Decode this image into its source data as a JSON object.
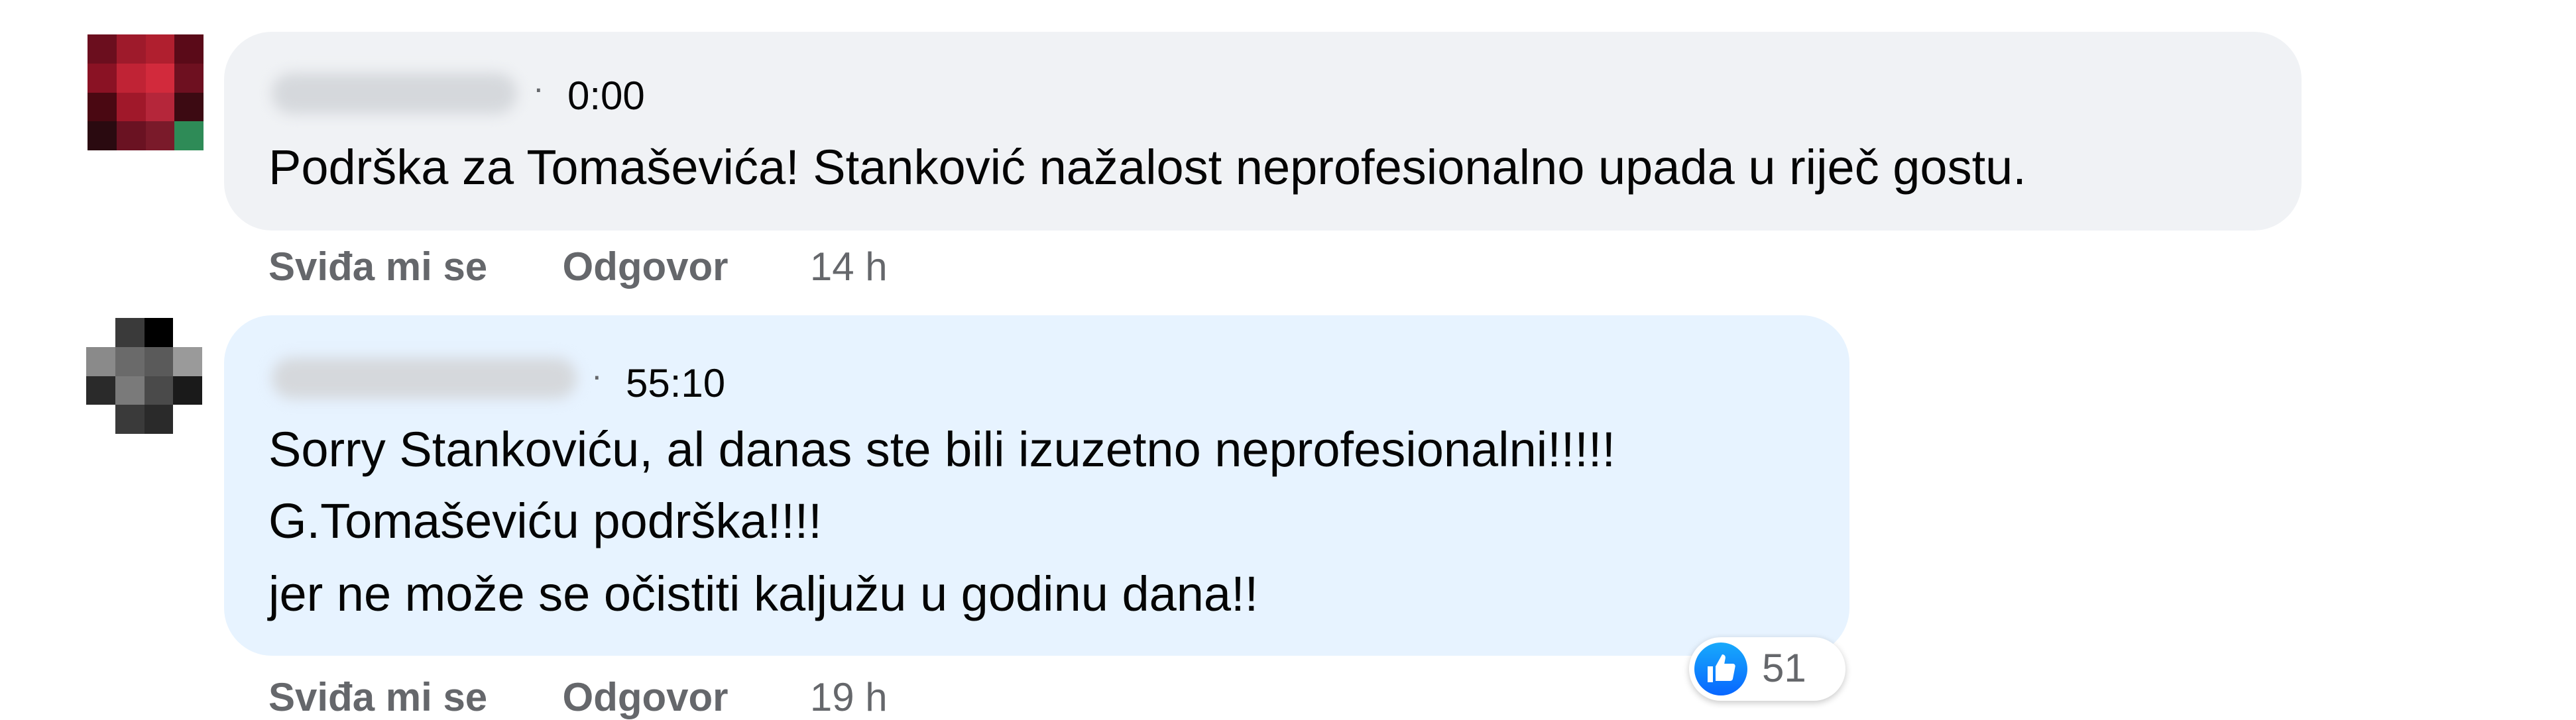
{
  "comments": [
    {
      "author": "",
      "video_timestamp": "0:00",
      "text_lines": [
        "Podrška za Tomaševića! Stanković nažalost neprofesionalno upada u riječ gostu."
      ],
      "like_label": "Sviđa mi se",
      "reply_label": "Odgovor",
      "time": "14 h",
      "avatar_colors": [
        "#6b0e1e",
        "#9e1a2b",
        "#b01f2f",
        "#5a0a18",
        "#8a1224",
        "#c02335",
        "#d22a3c",
        "#6e1020",
        "#4a0812",
        "#a0182a",
        "#b5263a",
        "#3c0a12",
        "#2a0a10",
        "#6a1222",
        "#7a1a2a",
        "#2e8b57"
      ]
    },
    {
      "author": "",
      "video_timestamp": "55:10",
      "text_lines": [
        "Sorry Stankoviću, al danas ste bili izuzetno neprofesionalni!!!!!",
        "G.Tomaševiću podrška!!!!",
        "jer ne može se očistiti kaljužu u godinu dana!!"
      ],
      "like_label": "Sviđa mi se",
      "reply_label": "Odgovor",
      "time": "19 h",
      "reaction_icon": "like-icon",
      "reaction_count": "51",
      "avatar_colors": [
        "#ffffff",
        "#3a3a3a",
        "#000000",
        "#ffffff",
        "#8a8a8a",
        "#6a6a6a",
        "#5a5a5a",
        "#9a9a9a",
        "#2a2a2a",
        "#7a7a7a",
        "#4a4a4a",
        "#1a1a1a",
        "#ffffff",
        "#3a3a3a",
        "#2a2a2a",
        "#ffffff"
      ]
    }
  ],
  "colors": {
    "bubble_gray": "#f0f2f5",
    "bubble_highlight": "#e7f3ff",
    "secondary_text": "#65676b",
    "like_blue": "#0866ff"
  }
}
